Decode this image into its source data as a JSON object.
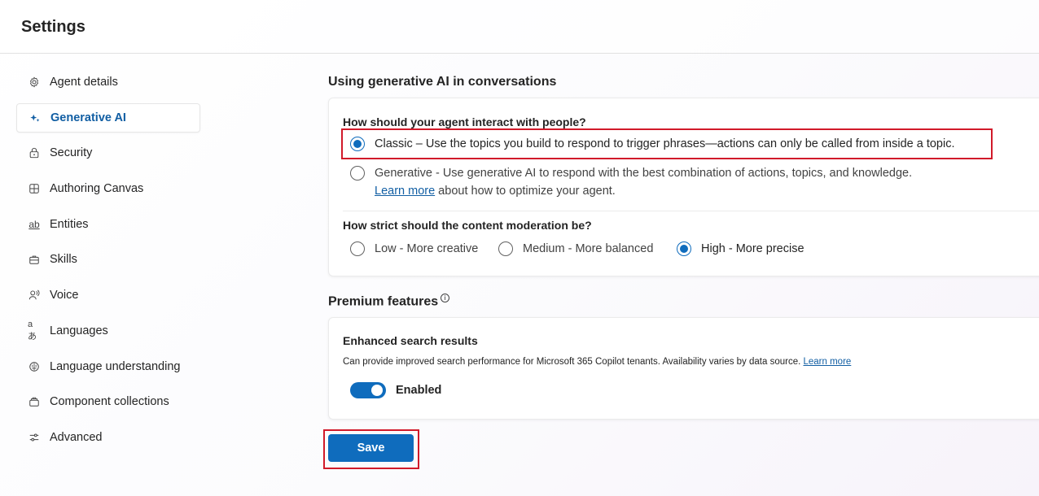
{
  "header": {
    "title": "Settings"
  },
  "sidebar": {
    "items": [
      {
        "label": "Agent details",
        "icon": "gear-icon",
        "active": false
      },
      {
        "label": "Generative AI",
        "icon": "sparkle-icon",
        "active": true
      },
      {
        "label": "Security",
        "icon": "lock-icon",
        "active": false
      },
      {
        "label": "Authoring Canvas",
        "icon": "grid-icon",
        "active": false
      },
      {
        "label": "Entities",
        "icon": "ab-text-icon",
        "active": false
      },
      {
        "label": "Skills",
        "icon": "toolbox-icon",
        "active": false
      },
      {
        "label": "Voice",
        "icon": "person-voice-icon",
        "active": false
      },
      {
        "label": "Languages",
        "icon": "translate-icon",
        "active": false
      },
      {
        "label": "Language understanding",
        "icon": "brain-icon",
        "active": false
      },
      {
        "label": "Component collections",
        "icon": "box-multiple-icon",
        "active": false
      },
      {
        "label": "Advanced",
        "icon": "sliders-icon",
        "active": false
      }
    ]
  },
  "main": {
    "gen_ai_section_title": "Using generative AI in conversations",
    "interaction": {
      "question": "How should your agent interact with people?",
      "options": [
        {
          "label": "Classic – Use the topics you build to respond to trigger phrases—actions can only be called from inside a topic.",
          "checked": true
        },
        {
          "label": "Generative - Use generative AI to respond with the best combination of actions, topics, and knowledge.",
          "checked": false
        }
      ],
      "learn_more_link": "Learn more",
      "learn_more_suffix": " about how to optimize your agent."
    },
    "moderation": {
      "question": "How strict should the content moderation be?",
      "options": [
        {
          "label": "Low - More creative",
          "checked": false
        },
        {
          "label": "Medium - More balanced",
          "checked": false
        },
        {
          "label": "High - More precise",
          "checked": true
        }
      ]
    },
    "premium": {
      "title": "Premium features",
      "info_icon": "info-icon",
      "feature_title": "Enhanced search results",
      "feature_desc": "Can provide improved search performance for Microsoft 365 Copilot tenants. Availability varies by data source.",
      "feature_link": "Learn more",
      "toggle_label": "Enabled",
      "toggle_on": true
    },
    "save_label": "Save"
  },
  "colors": {
    "accent": "#0f6cbd",
    "highlight": "#d11a2a"
  }
}
